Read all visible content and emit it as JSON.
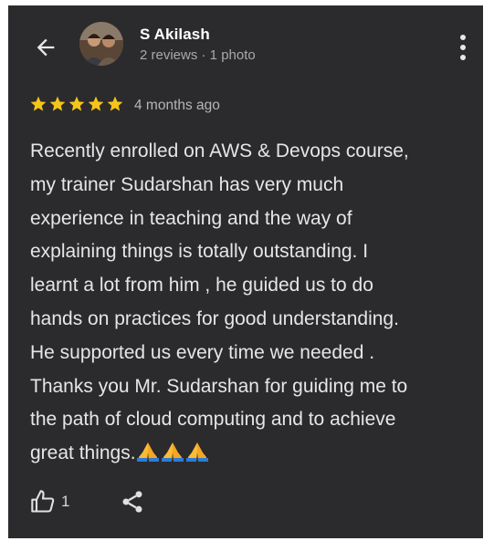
{
  "reviewer": {
    "name": "S Akilash",
    "meta": "2 reviews · 1 photo"
  },
  "review": {
    "rating": 5,
    "max_rating": 5,
    "time_ago": "4 months ago",
    "text": "Recently enrolled on AWS & Devops course,\nmy trainer Sudarshan has very much\nexperience in teaching and the way of\nexplaining things is totally outstanding. I\nlearnt a lot from him , he guided us to do\nhands on practices for good understanding.\nHe supported us every time we needed .\nThanks you Mr. Sudarshan for guiding me to\nthe path of cloud computing and to achieve\ngreat things.",
    "emojis": [
      "folded-hands-icon",
      "folded-hands-icon",
      "folded-hands-icon"
    ]
  },
  "actions": {
    "like_count": "1"
  },
  "icons": {
    "back": "arrow-left-icon",
    "more": "more-vertical-icon",
    "like": "thumbs-up-icon",
    "share": "share-icon"
  },
  "colors": {
    "background": "#2b2b2d",
    "star": "#f5c518",
    "name_text": "#ffffff",
    "secondary_text": "#a9a9ad",
    "body_text": "#e6e6e8"
  }
}
